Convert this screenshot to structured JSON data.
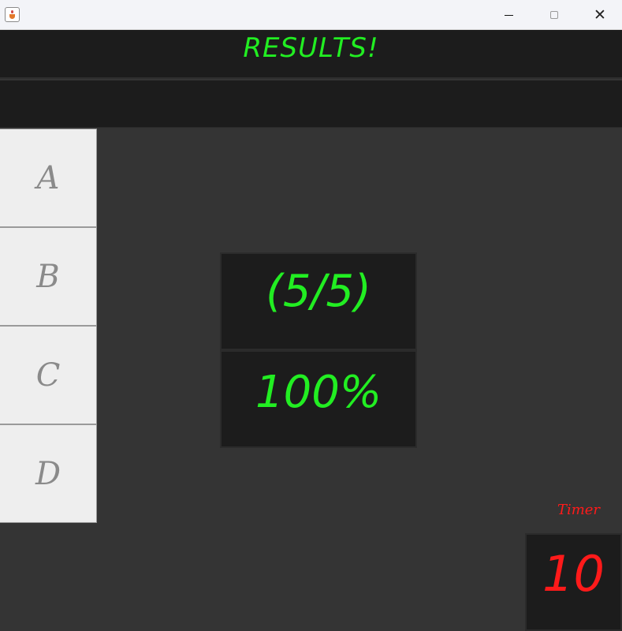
{
  "titlebar": {
    "controls": {
      "minimize": "minimize-icon",
      "maximize": "maximize-icon",
      "close": "close-icon"
    }
  },
  "header": {
    "title": "RESULTS!"
  },
  "answers": [
    {
      "label": "A"
    },
    {
      "label": "B"
    },
    {
      "label": "C"
    },
    {
      "label": "D"
    }
  ],
  "score": {
    "fraction": "(5/5)",
    "percent": "100%"
  },
  "timer": {
    "label": "Timer",
    "value": "10"
  },
  "colors": {
    "accent_green": "#22ee22",
    "timer_red": "#ff1a1a",
    "panel_dark": "#1c1c1c",
    "background": "#343434",
    "button_light": "#eeeeee"
  }
}
